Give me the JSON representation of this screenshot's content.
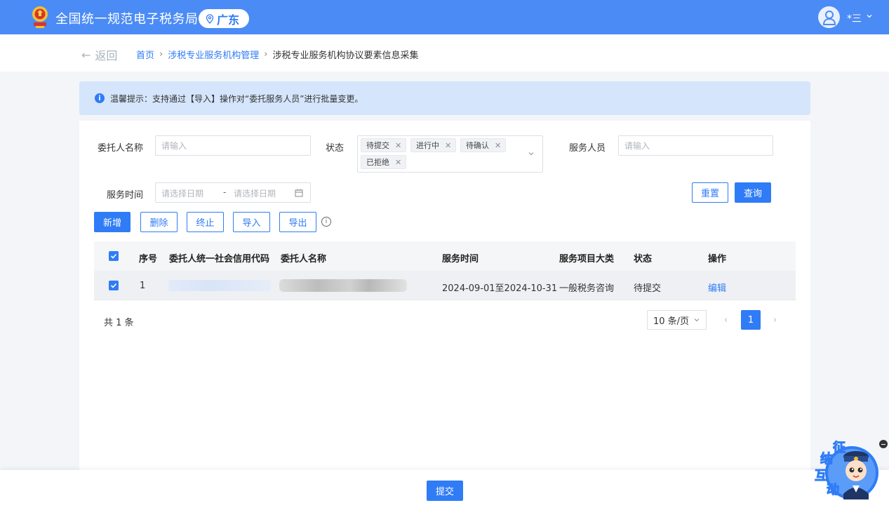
{
  "header": {
    "site_title": "全国统一规范电子税务局",
    "region": "广东",
    "user_name": "*三",
    "brand_color": "#4b8bf5"
  },
  "breadcrumb": {
    "back_label": "返回",
    "items": [
      "首页",
      "涉税专业服务机构管理",
      "涉税专业服务机构协议要素信息采集"
    ]
  },
  "notice": {
    "text": "温馨提示：支持通过【导入】操作对“委托服务人员”进行批量变更。"
  },
  "filters": {
    "client_name_label": "委托人名称",
    "client_name_placeholder": "请输入",
    "status_label": "状态",
    "status_tags": [
      "待提交",
      "进行中",
      "待确认",
      "已拒绝"
    ],
    "service_staff_label": "服务人员",
    "service_staff_placeholder": "请输入",
    "service_time_label": "服务时间",
    "start_date_placeholder": "请选择日期",
    "date_separator": "-",
    "end_date_placeholder": "请选择日期",
    "reset_label": "重置",
    "query_label": "查询"
  },
  "toolbar": {
    "add_label": "新增",
    "delete_label": "删除",
    "terminate_label": "终止",
    "import_label": "导入",
    "export_label": "导出",
    "info_glyph": "i"
  },
  "table": {
    "columns": [
      "序号",
      "委托人统一社会信用代码",
      "委托人名称",
      "服务时间",
      "服务项目大类",
      "状态",
      "操作"
    ],
    "rows": [
      {
        "index": "1",
        "credit_code": "",
        "client_name": "",
        "service_time": "2024-09-01至2024-10-31",
        "category": "一般税务咨询",
        "status": "待提交",
        "action": "编辑",
        "checked": true
      }
    ],
    "header_checked": true
  },
  "pagination": {
    "total_text": "共 1 条",
    "page_size": "10 条/页",
    "prev": "‹",
    "current_page": "1",
    "next": "›"
  },
  "footer": {
    "submit_label": "提交"
  },
  "mascot": {
    "chars": [
      "征",
      "纳",
      "互",
      "动"
    ]
  }
}
